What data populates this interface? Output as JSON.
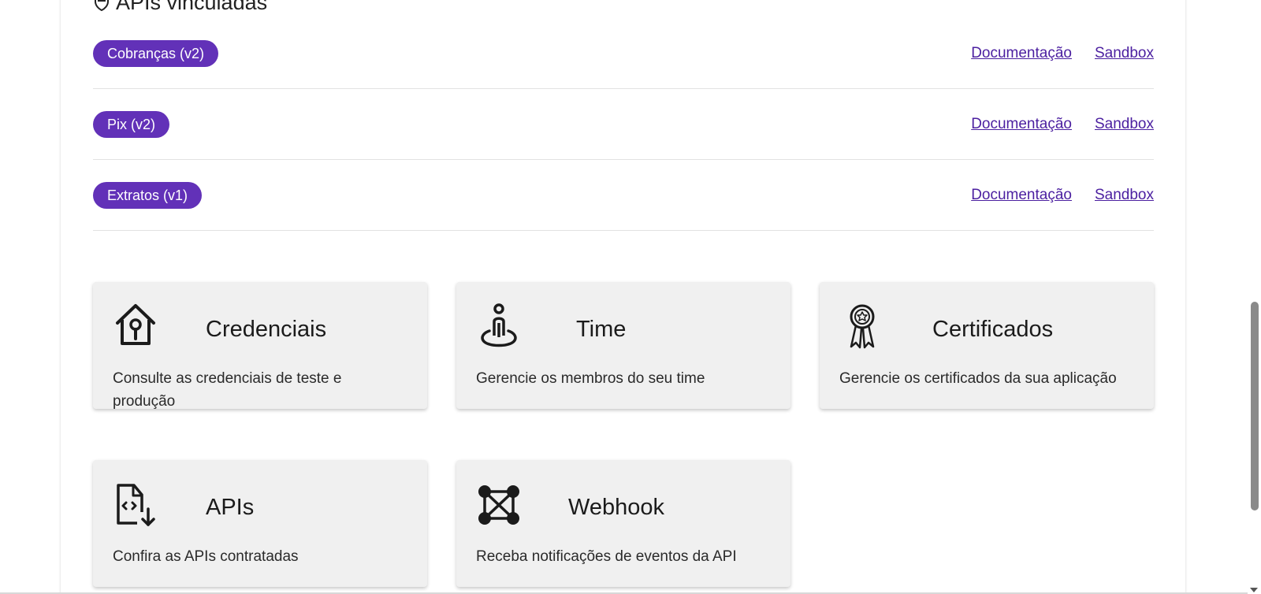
{
  "section": {
    "title": "APIs vinculadas",
    "icon": "shield-icon"
  },
  "apis": [
    {
      "name": "Cobranças (v2)",
      "doc_label": "Documentação",
      "sandbox_label": "Sandbox"
    },
    {
      "name": "Pix (v2)",
      "doc_label": "Documentação",
      "sandbox_label": "Sandbox"
    },
    {
      "name": "Extratos (v1)",
      "doc_label": "Documentação",
      "sandbox_label": "Sandbox"
    }
  ],
  "cards": [
    {
      "title": "Credenciais",
      "description": "Consulte as credenciais de teste e produção",
      "icon": "house-lock-icon"
    },
    {
      "title": "Time",
      "description": "Gerencie os membros do seu time",
      "icon": "person-location-icon"
    },
    {
      "title": "Certificados",
      "description": "Gerencie os certificados da sua aplicação",
      "icon": "award-ribbon-icon"
    },
    {
      "title": "APIs",
      "description": "Confira as APIs contratadas",
      "icon": "code-file-download-icon"
    },
    {
      "title": "Webhook",
      "description": "Receba notificações de eventos da API",
      "icon": "network-nodes-icon"
    }
  ],
  "colors": {
    "pill": "#6231b8",
    "link": "#4b1fa0",
    "card_bg": "#f0f0f0"
  }
}
